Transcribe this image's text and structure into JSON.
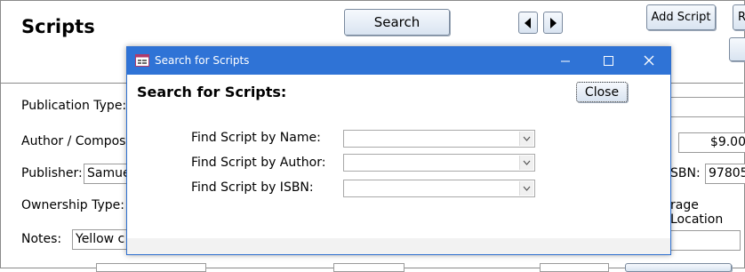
{
  "window": {
    "title": "Scripts",
    "search_button": "Search",
    "add_script_button": "Add Script",
    "right_cut_button": "R",
    "nav_prev_icon": "triangle-left-icon",
    "nav_next_icon": "triangle-right-icon"
  },
  "form": {
    "publication_type_label": "Publication Type:",
    "author_label": "Author / Compose",
    "publisher_label": "Publisher:",
    "publisher_value": "Samue",
    "ownership_label": "Ownership Type:",
    "notes_label": "Notes:",
    "notes_value": "Yellow c",
    "price_value": "$9.00",
    "isbn_label": "SBN:",
    "isbn_value": "97805",
    "storage_label": "rage Location"
  },
  "dialog": {
    "titlebar_text": "Search for Scripts",
    "heading": "Search for Scripts:",
    "close_button": "Close",
    "rows": [
      {
        "label": "Find Script by Name:",
        "value": ""
      },
      {
        "label": "Find Script by Author:",
        "value": ""
      },
      {
        "label": "Find Script by ISBN:",
        "value": ""
      }
    ],
    "colors": {
      "titlebar": "#2f73d6",
      "accent": "#2e6fcf"
    }
  }
}
